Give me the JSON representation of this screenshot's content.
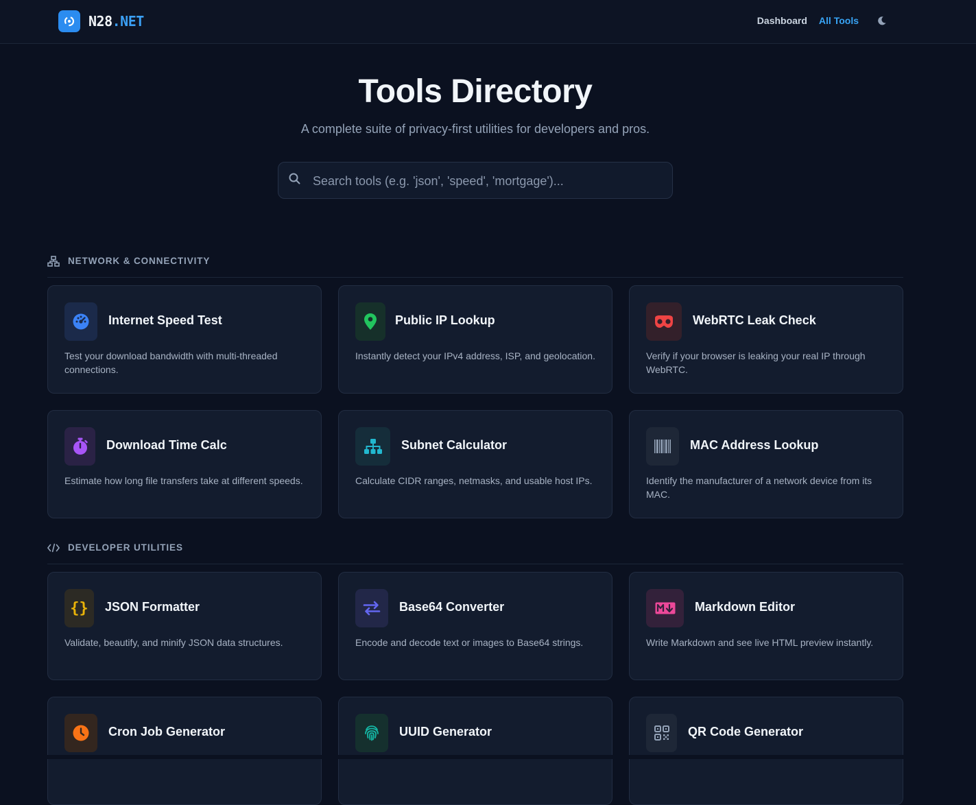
{
  "header": {
    "logo_main": "N28",
    "logo_accent": ".NET",
    "nav": {
      "dashboard": "Dashboard",
      "all_tools": "All Tools"
    }
  },
  "hero": {
    "title": "Tools Directory",
    "subtitle": "A complete suite of privacy-first utilities for developers and pros.",
    "search_placeholder": "Search tools (e.g. 'json', 'speed', 'mortgage')..."
  },
  "sections": [
    {
      "label": "NETWORK & CONNECTIVITY",
      "icon": "network-icon",
      "tools": [
        {
          "title": "Internet Speed Test",
          "desc": "Test your download bandwidth with multi-threaded connections.",
          "icon": "gauge-icon",
          "color": "#3b82f6",
          "bg": "#1b2a4a"
        },
        {
          "title": "Public IP Lookup",
          "desc": "Instantly detect your IPv4 address, ISP, and geolocation.",
          "icon": "map-pin-icon",
          "color": "#22c55e",
          "bg": "#16302a"
        },
        {
          "title": "WebRTC Leak Check",
          "desc": "Verify if your browser is leaking your real IP through WebRTC.",
          "icon": "mask-icon",
          "color": "#ef4444",
          "bg": "#33202a"
        },
        {
          "title": "Download Time Calc",
          "desc": "Estimate how long file transfers take at different speeds.",
          "icon": "stopwatch-icon",
          "color": "#a855f7",
          "bg": "#2a2245"
        },
        {
          "title": "Subnet Calculator",
          "desc": "Calculate CIDR ranges, netmasks, and usable host IPs.",
          "icon": "sitemap-icon",
          "color": "#22b8cf",
          "bg": "#152d3a"
        },
        {
          "title": "MAC Address Lookup",
          "desc": "Identify the manufacturer of a network device from its MAC.",
          "icon": "barcode-icon",
          "color": "#94a3b8",
          "bg": "#1e2737"
        }
      ]
    },
    {
      "label": "DEVELOPER UTILITIES",
      "icon": "code-icon",
      "tools": [
        {
          "title": "JSON Formatter",
          "desc": "Validate, beautify, and minify JSON data structures.",
          "icon": "braces-icon",
          "color": "#eab308",
          "bg": "#2c2a24"
        },
        {
          "title": "Base64 Converter",
          "desc": "Encode and decode text or images to Base64 strings.",
          "icon": "swap-arrows-icon",
          "color": "#6366f1",
          "bg": "#222748"
        },
        {
          "title": "Markdown Editor",
          "desc": "Write Markdown and see live HTML preview instantly.",
          "icon": "markdown-icon",
          "color": "#ec4899",
          "bg": "#33213a"
        },
        {
          "title": "Cron Job Generator",
          "desc": "",
          "icon": "clock-icon",
          "color": "#f97316",
          "bg": "#33261f"
        },
        {
          "title": "UUID Generator",
          "desc": "",
          "icon": "fingerprint-icon",
          "color": "#14b8a6",
          "bg": "#15302e"
        },
        {
          "title": "QR Code Generator",
          "desc": "",
          "icon": "qr-code-icon",
          "color": "#94a3b8",
          "bg": "#1e2737"
        }
      ]
    }
  ]
}
